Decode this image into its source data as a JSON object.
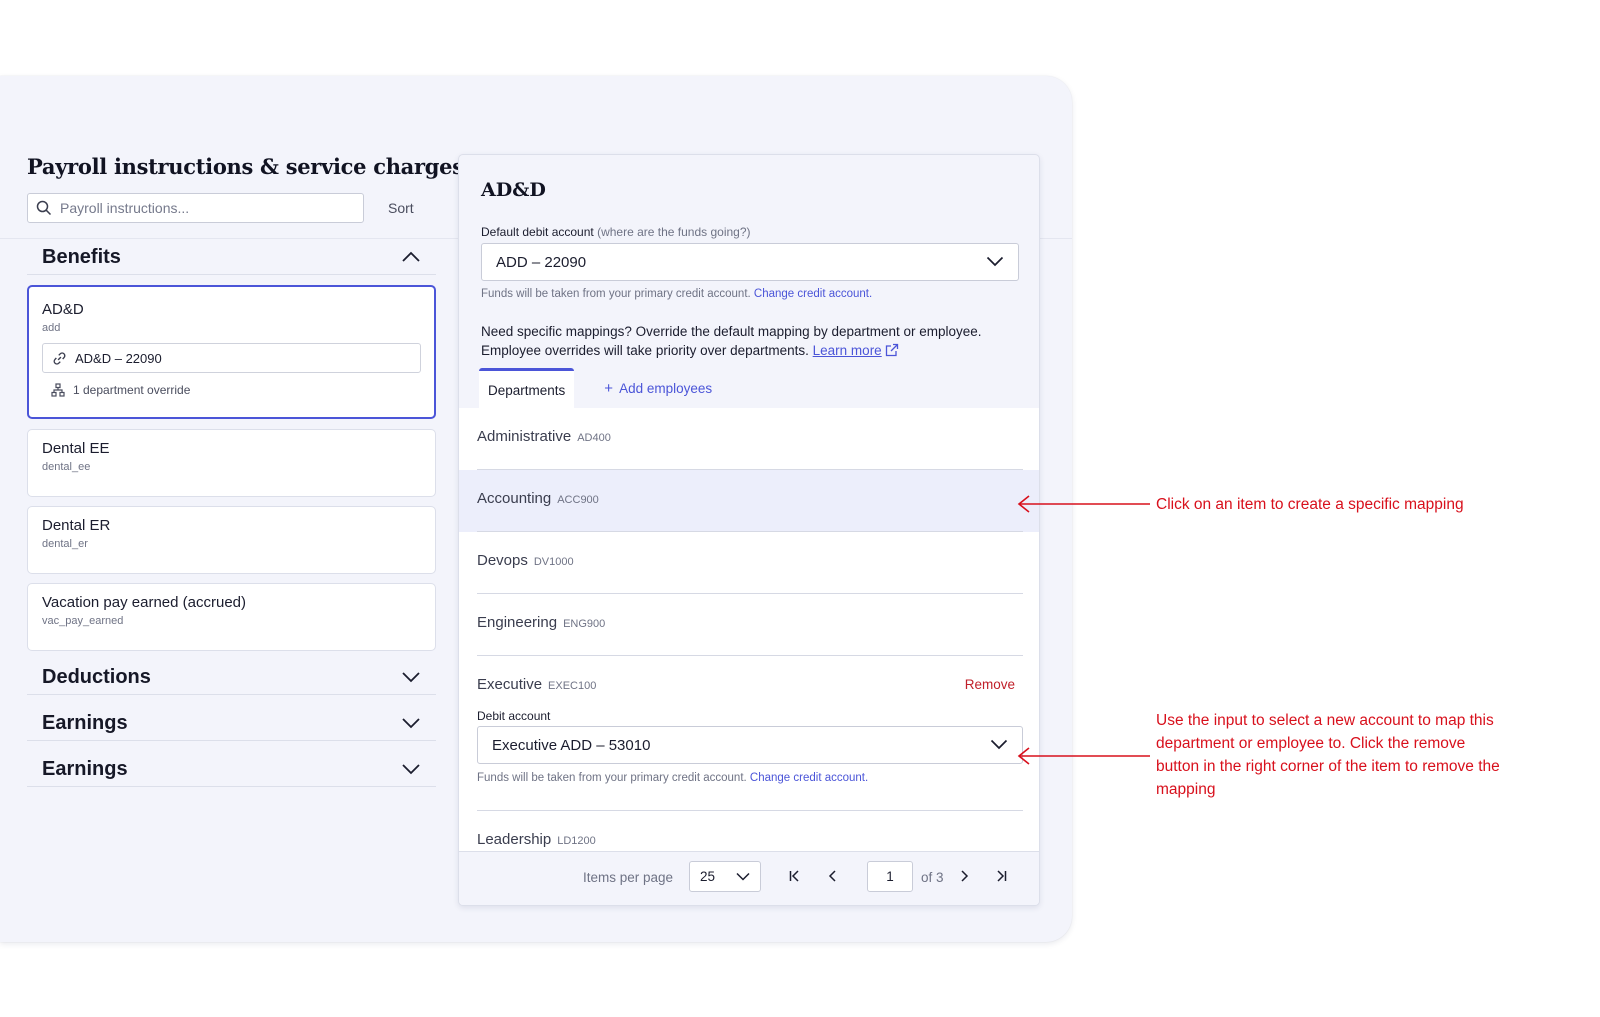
{
  "left": {
    "title": "Payroll instructions & service charges",
    "search_placeholder": "Payroll instructions...",
    "sort_label": "Sort",
    "sections": {
      "benefits": "Benefits",
      "deductions": "Deductions",
      "earnings_1": "Earnings",
      "earnings_2": "Earnings"
    },
    "items": [
      {
        "name": "AD&D",
        "code": "add",
        "account": "AD&D – 22090",
        "override": "1 department override"
      },
      {
        "name": "Dental EE",
        "code": "dental_ee"
      },
      {
        "name": "Dental ER",
        "code": "dental_er"
      },
      {
        "name": "Vacation pay earned (accrued)",
        "code": "vac_pay_earned"
      }
    ]
  },
  "panel": {
    "title": "AD&D",
    "debit_label": "Default debit account",
    "debit_hint": "(where are the funds going?)",
    "debit_value": "ADD – 22090",
    "helper_text": "Funds will be taken from your primary credit account.",
    "helper_link": "Change credit account.",
    "desc_line1": "Need specific mappings? Override the default mapping by department or employee.",
    "desc_line2": "Employee overrides will take priority over departments.",
    "learn_more": "Learn more",
    "tabs": {
      "departments": "Departments",
      "add_employees": "Add employees"
    },
    "departments": [
      {
        "name": "Administrative",
        "code": "AD400"
      },
      {
        "name": "Accounting",
        "code": "ACC900"
      },
      {
        "name": "Devops",
        "code": "DV1000"
      },
      {
        "name": "Engineering",
        "code": "ENG900"
      },
      {
        "name": "Executive",
        "code": "EXEC100"
      },
      {
        "name": "Leadership",
        "code": "LD1200"
      }
    ],
    "executive": {
      "remove_label": "Remove",
      "field_label": "Debit account",
      "value": "Executive ADD – 53010",
      "helper_text": "Funds will be taken from your primary credit account.",
      "helper_link": "Change credit account."
    },
    "pager": {
      "items_per_page_label": "Items per page",
      "items_per_page": "25",
      "page": "1",
      "of_label": "of 3"
    }
  },
  "annotations": {
    "first": "Click on an item to create a specific mapping",
    "second_line1": "Use the input to select a new account to map this",
    "second_line2": "department or employee to. Click the remove",
    "second_line3": "button in the right corner of the item to remove the",
    "second_line4": "mapping"
  },
  "colors": {
    "accent": "#4b55d8",
    "annotation": "#d8101c",
    "danger": "#c0202a",
    "panel_bg": "#f3f4fb"
  }
}
